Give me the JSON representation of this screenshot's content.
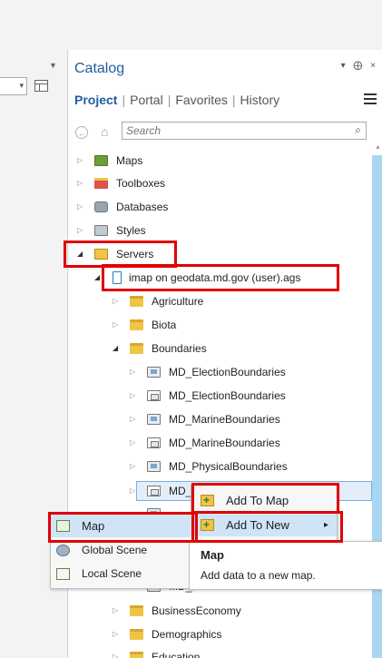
{
  "catalog": {
    "title": "Catalog",
    "pin": "▾ ⨁ ×",
    "tabs": [
      "Project",
      "Portal",
      "Favorites",
      "History"
    ],
    "search_placeholder": "Search",
    "search_icon_glyph": "⌕"
  },
  "tree": {
    "maps": "Maps",
    "toolboxes": "Toolboxes",
    "databases": "Databases",
    "styles": "Styles",
    "servers": "Servers",
    "connection": "imap on geodata.md.gov (user).ags",
    "agriculture": "Agriculture",
    "biota": "Biota",
    "boundaries": "Boundaries",
    "children": [
      "MD_ElectionBoundaries",
      "MD_ElectionBoundaries",
      "MD_MarineBoundaries",
      "MD_MarineBoundaries",
      "MD_PhysicalBoundaries"
    ],
    "partial_selected": "MD_",
    "partial_hidden": "MD_",
    "business": "BusinessEconomy",
    "demographics": "Demographics",
    "education": "Education"
  },
  "context_menu": {
    "add_to_map": "Add To Map",
    "add_to_new": "Add To New",
    "submenu_arrow": "▸"
  },
  "submenu": {
    "items": [
      "Map",
      "Global Scene",
      "Local Scene"
    ]
  },
  "tooltip": {
    "title": "Map",
    "description": "Add data to a new map."
  }
}
